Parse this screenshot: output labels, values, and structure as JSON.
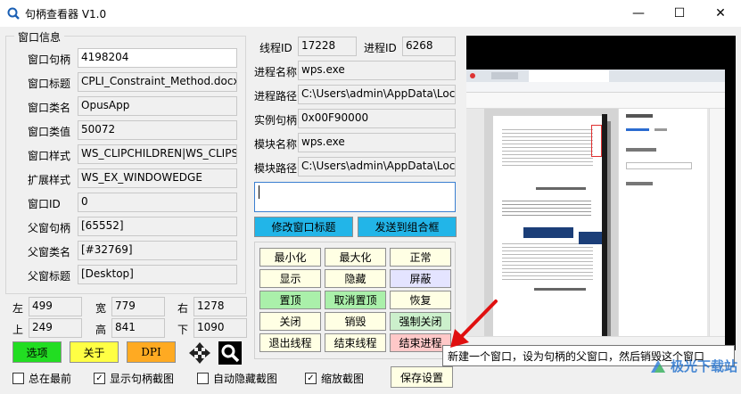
{
  "window": {
    "title": "句柄查看器 V1.0",
    "min_glyph": "—",
    "max_glyph": "☐",
    "close_glyph": "✕"
  },
  "group_title": "窗口信息",
  "left_fields": [
    {
      "label": "窗口句柄",
      "value": "4198204"
    },
    {
      "label": "窗口标题",
      "value": "CPLI_Constraint_Method.docx -"
    },
    {
      "label": "窗口类名",
      "value": "OpusApp"
    },
    {
      "label": "窗口类值",
      "value": "50072"
    },
    {
      "label": "窗口样式",
      "value": "WS_CLIPCHILDREN|WS_CLIPSI"
    },
    {
      "label": "扩展样式",
      "value": "WS_EX_WINDOWEDGE"
    },
    {
      "label": "窗口ID",
      "value": "0"
    },
    {
      "label": "父窗句柄",
      "value": "[65552]"
    },
    {
      "label": "父窗类名",
      "value": "[#32769]"
    },
    {
      "label": "父窗标题",
      "value": "[Desktop]"
    }
  ],
  "geometry": {
    "left_label": "左",
    "left_value": "499",
    "width_label": "宽",
    "width_value": "779",
    "right_label": "右",
    "right_value": "1278",
    "top_label": "上",
    "top_value": "249",
    "height_label": "高",
    "height_value": "841",
    "bottom_label": "下",
    "bottom_value": "1090"
  },
  "bottom_buttons": {
    "options": "选项",
    "about": "关于",
    "dpi": "DPI"
  },
  "thread": {
    "label": "线程ID",
    "value": "17228"
  },
  "process": {
    "label": "进程ID",
    "value": "6268"
  },
  "mid_fields": [
    {
      "label": "进程名称",
      "value": "wps.exe"
    },
    {
      "label": "进程路径",
      "value": "C:\\Users\\admin\\AppData\\Local\\"
    },
    {
      "label": "实例句柄",
      "value": "0x00F90000"
    },
    {
      "label": "模块名称",
      "value": "wps.exe"
    },
    {
      "label": "模块路径",
      "value": "C:\\Users\\admin\\AppData\\Local\\"
    }
  ],
  "edit_box": {
    "value": ""
  },
  "modify_title_btn": "修改窗口标题",
  "send_combo_btn": "发送到组合框",
  "action_buttons": [
    [
      "最小化",
      "最大化",
      "正常"
    ],
    [
      "显示",
      "隐藏",
      "屏蔽"
    ],
    [
      "置顶",
      "取消置顶",
      "恢复"
    ],
    [
      "关闭",
      "销毁",
      "强制关闭"
    ],
    [
      "退出线程",
      "结束线程",
      "结束进程"
    ]
  ],
  "checkboxes": [
    {
      "label": "总在最前",
      "checked": false
    },
    {
      "label": "显示句柄截图",
      "checked": true
    },
    {
      "label": "自动隐藏截图",
      "checked": false
    },
    {
      "label": "缩放截图",
      "checked": true
    }
  ],
  "save_btn": "保存设置",
  "tooltip": "新建一个窗口，设为句柄的父窗口，然后销毁这个窗口",
  "watermark": "极光下载站",
  "colors": {
    "options_green": "#22dd22",
    "about_yellow": "#ffff44",
    "dpi_orange": "#ffaa22",
    "cyan_btn": "#22b5e8",
    "end_process_pink": "#ffc8c8"
  }
}
